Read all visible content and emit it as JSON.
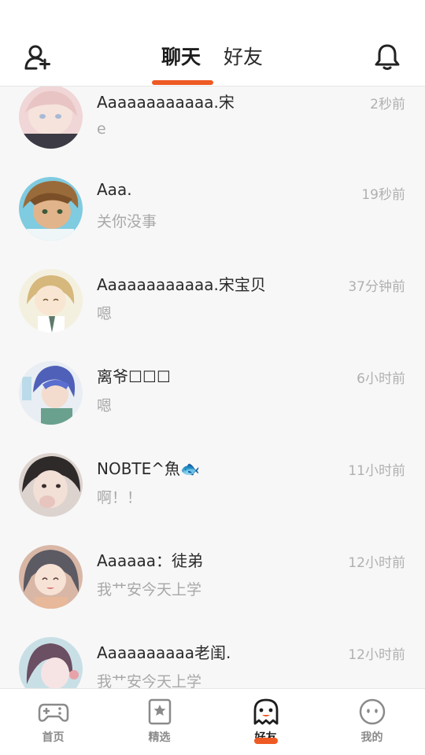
{
  "header": {
    "tabs": [
      {
        "label": "聊天",
        "active": true
      },
      {
        "label": "好友",
        "active": false
      }
    ],
    "accent_color": "#ee5a24"
  },
  "chats": [
    {
      "name": "Aaaaaaaaaaaa.宋",
      "preview": "e",
      "time": "2秒前"
    },
    {
      "name": "Aaa.",
      "preview": "关你没事",
      "time": "19秒前"
    },
    {
      "name": "Aaaaaaaaaaaa.宋宝贝",
      "preview": "嗯",
      "time": "37分钟前"
    },
    {
      "name": "离爷☐☐☐",
      "preview": "嗯",
      "time": "6小时前"
    },
    {
      "name": "NOBTE^魚🐟",
      "preview": "啊！！",
      "time": "11小时前"
    },
    {
      "name": "Aaaaaa：徒弟",
      "preview": "我艹安今天上学",
      "time": "12小时前"
    },
    {
      "name": "Aaaaaaaaaa老闺.",
      "preview": "我艹安今天上学",
      "time": "12小时前"
    }
  ],
  "bottom_nav": [
    {
      "label": "首页",
      "icon": "gamepad-icon",
      "active": false
    },
    {
      "label": "精选",
      "icon": "star-bookmark-icon",
      "active": false
    },
    {
      "label": "好友",
      "icon": "ghost-icon",
      "active": true
    },
    {
      "label": "我的",
      "icon": "face-icon",
      "active": false
    }
  ]
}
